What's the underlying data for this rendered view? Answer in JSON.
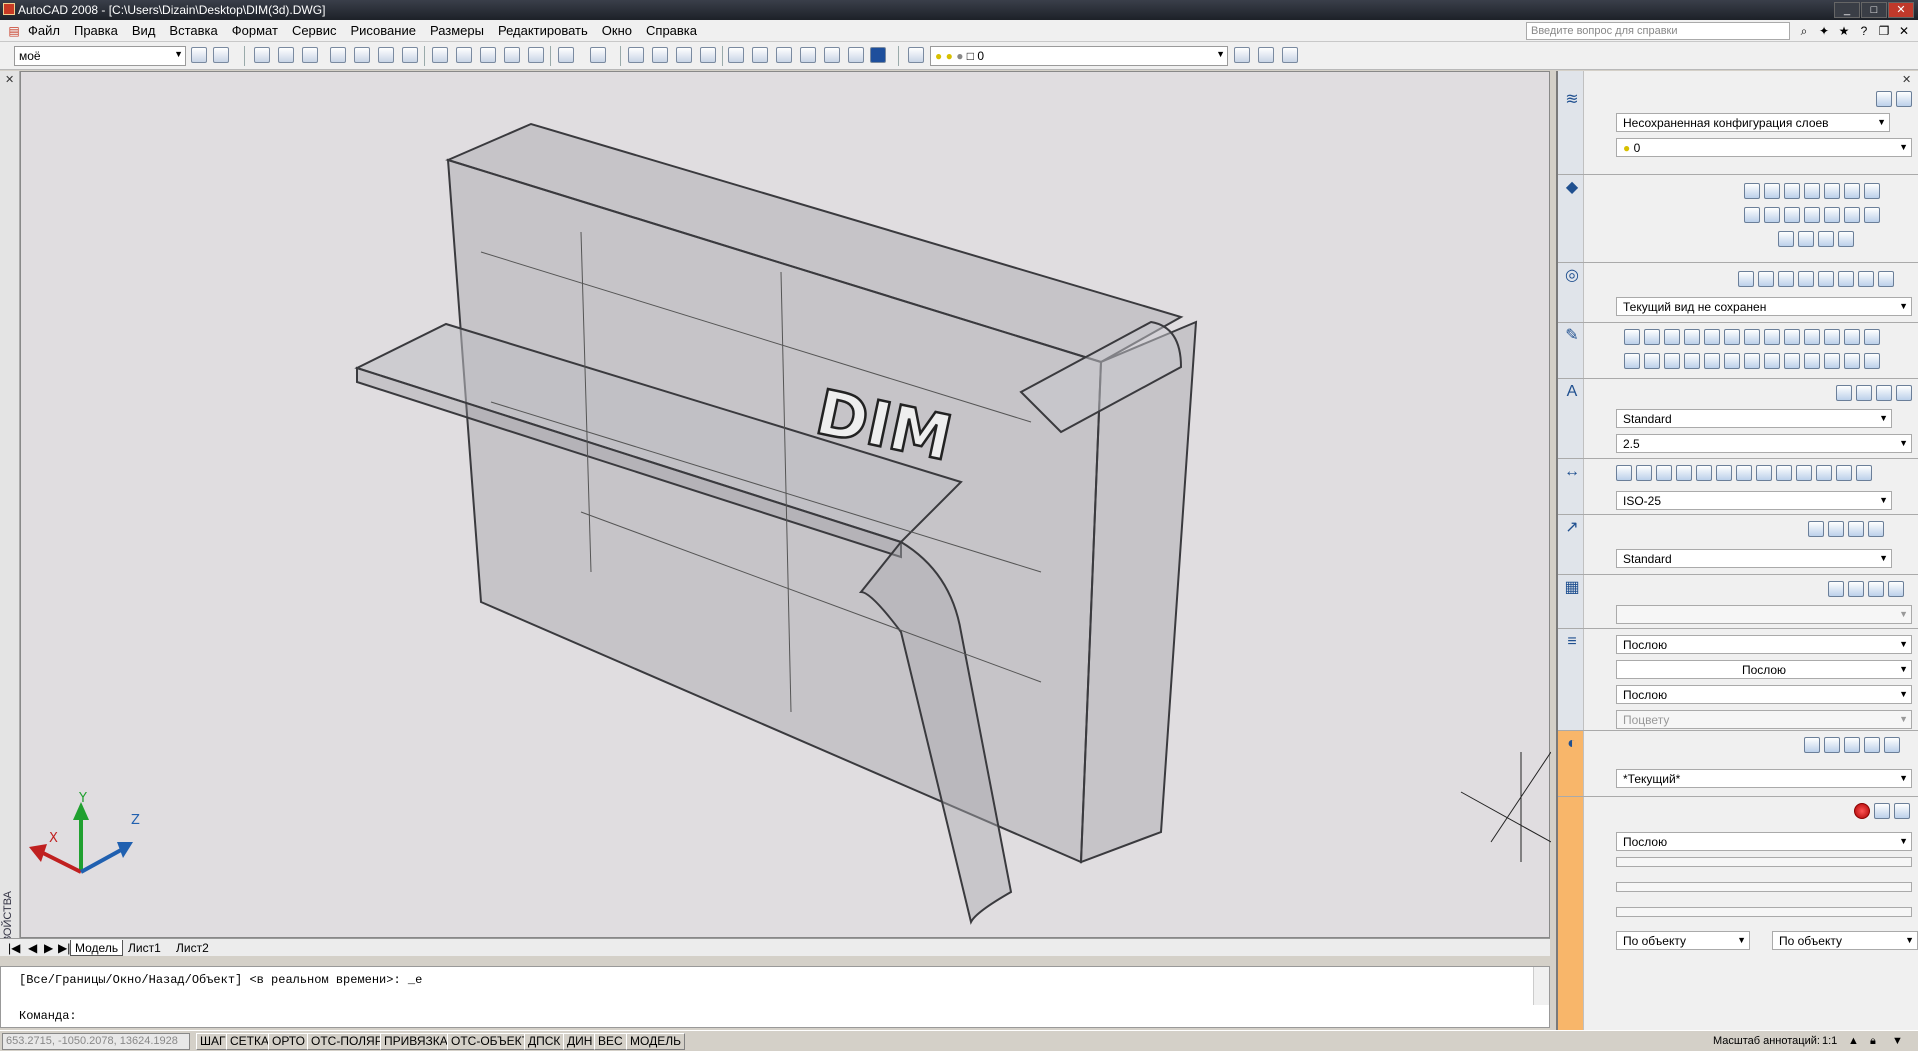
{
  "window": {
    "title": "AutoCAD 2008 - [C:\\Users\\Dizain\\Desktop\\DIM(3d).DWG]",
    "help_placeholder": "Введите вопрос для справки"
  },
  "menu": [
    "Файл",
    "Правка",
    "Вид",
    "Вставка",
    "Формат",
    "Сервис",
    "Рисование",
    "Размеры",
    "Редактировать",
    "Окно",
    "Справка"
  ],
  "toolbar": {
    "workspace": "моё",
    "layer": "0"
  },
  "drawing": {
    "logo_text": "DIM",
    "ucs": {
      "x": "X",
      "y": "Y",
      "z": "Z"
    }
  },
  "left_strip_label": "СВОЙСТВА",
  "tabs": [
    "Модель",
    "Лист1",
    "Лист2"
  ],
  "command": {
    "history": "[Все/Границы/Окно/Назад/Объект] <в реальном времени>: _e",
    "prompt": "Команда:"
  },
  "status": {
    "coords": "653.2715, -1050.2078, 13624.1928",
    "buttons": [
      "ШАГ",
      "СЕТКА",
      "ОРТО",
      "ОТС-ПОЛЯР",
      "ПРИВЯЗКА",
      "ОТС-ОБЪЕКТ",
      "ДПСК",
      "ДИН",
      "ВЕС",
      "МОДЕЛЬ"
    ],
    "annotation_scale_label": "Масштаб аннотаций:",
    "annotation_scale_value": "1:1"
  },
  "palette": {
    "layer_state": "Несохраненная конфигурация слоев",
    "layer_current": "0",
    "view_current": "Текущий вид не сохранен",
    "text_style": "Standard",
    "text_height": "2.5",
    "dim_style": "ISO-25",
    "mleader_style": "Standard",
    "color": "Послою",
    "linetype": "Послою",
    "lineweight": "Послою",
    "plot_style": "Поцвету",
    "visual_style": "*Текущий*",
    "material": "Послою",
    "shadow_left": "По объекту",
    "shadow_right": "По объекту"
  },
  "colors": {
    "titlebar": "#1d2128",
    "drawing_bg": "#e0dde0",
    "palette_accent": "#f8b66a"
  }
}
